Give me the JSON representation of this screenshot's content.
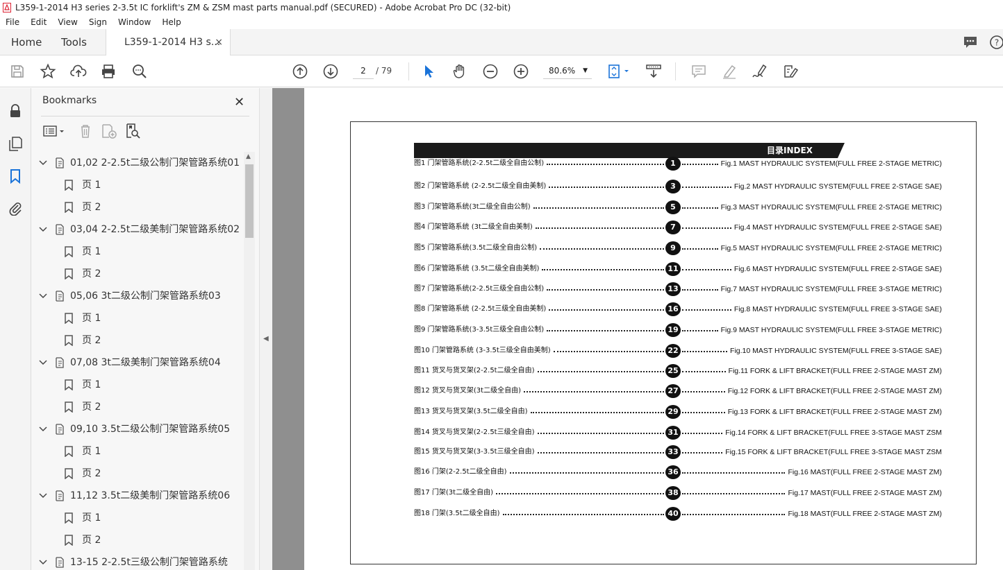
{
  "window": {
    "title": "L359-1-2014 H3 series 2-3.5t IC forklift's ZM & ZSM mast parts manual.pdf (SECURED) - Adobe Acrobat Pro DC (32-bit)"
  },
  "menu": [
    "File",
    "Edit",
    "View",
    "Sign",
    "Window",
    "Help"
  ],
  "tabs": {
    "home": "Home",
    "tools": "Tools",
    "document": "L359-1-2014 H3 s...",
    "close": "×"
  },
  "toolbar": {
    "page_current": "2",
    "page_total": "/ 79",
    "zoom": "80.6%"
  },
  "bookmarks": {
    "title": "Bookmarks",
    "close": "✕",
    "items": [
      {
        "label": "01,02 2-2.5t二级公制门架管路系统01",
        "children": [
          "页 1",
          "页 2"
        ]
      },
      {
        "label": "03,04 2-2.5t二级美制门架管路系统02",
        "children": [
          "页 1",
          "页 2"
        ]
      },
      {
        "label": "05,06 3t二级公制门架管路系统03",
        "children": [
          "页 1",
          "页 2"
        ]
      },
      {
        "label": "07,08 3t二级美制门架管路系统04",
        "children": [
          "页 1",
          "页 2"
        ]
      },
      {
        "label": "09,10 3.5t二级公制门架管路系统05",
        "children": [
          "页 1",
          "页 2"
        ]
      },
      {
        "label": "11,12 3.5t二级美制门架管路系统06",
        "children": [
          "页 1",
          "页 2"
        ]
      },
      {
        "label": "13-15 2-2.5t三级公制门架管路系统",
        "children": []
      }
    ]
  },
  "document": {
    "header": "目录INDEX",
    "entries": [
      {
        "left": "图1  门架管路系统(2-2.5t二级全自由公制)",
        "num": "1",
        "right": "Fig.1 MAST HYDRAULIC SYSTEM(FULL FREE 2-STAGE METRIC)"
      },
      {
        "left": "图2  门架管路系统 (2-2.5t二级全自由美制)",
        "num": "3",
        "right": "Fig.2 MAST HYDRAULIC SYSTEM(FULL FREE 2-STAGE SAE)"
      },
      {
        "left": "图3  门架管路系统(3t二级全自由公制)",
        "num": "5",
        "right": "Fig.3 MAST HYDRAULIC SYSTEM(FULL FREE 2-STAGE METRIC)"
      },
      {
        "left": "图4  门架管路系统 (3t二级全自由美制)",
        "num": "7",
        "right": "Fig.4 MAST HYDRAULIC SYSTEM(FULL FREE 2-STAGE SAE)"
      },
      {
        "left": "图5  门架管路系统(3.5t二级全自由公制)",
        "num": "9",
        "right": "Fig.5 MAST HYDRAULIC SYSTEM(FULL FREE 2-STAGE METRIC)"
      },
      {
        "left": "图6  门架管路系统 (3.5t二级全自由美制)",
        "num": "11",
        "right": "Fig.6 MAST HYDRAULIC SYSTEM(FULL FREE 2-STAGE SAE)"
      },
      {
        "left": "图7  门架管路系统(2-2.5t三级全自由公制)",
        "num": "13",
        "right": "Fig.7 MAST HYDRAULIC SYSTEM(FULL FREE 3-STAGE METRIC)"
      },
      {
        "left": "图8  门架管路系统 (2-2.5t三级全自由美制)",
        "num": "16",
        "right": "Fig.8 MAST HYDRAULIC SYSTEM(FULL FREE 3-STAGE SAE)"
      },
      {
        "left": "图9  门架管路系统(3-3.5t三级全自由公制)",
        "num": "19",
        "right": "Fig.9 MAST HYDRAULIC SYSTEM(FULL FREE 3-STAGE METRIC)"
      },
      {
        "left": "图10  门架管路系统 (3-3.5t三级全自由美制)",
        "num": "22",
        "right": "Fig.10 MAST HYDRAULIC SYSTEM(FULL FREE 3-STAGE SAE)"
      },
      {
        "left": "图11  货叉与货叉架(2-2.5t二级全自由)",
        "num": "25",
        "right": "Fig.11 FORK & LIFT BRACKET(FULL FREE 2-STAGE MAST ZM)"
      },
      {
        "left": "图12  货叉与货叉架(3t二级全自由)",
        "num": "27",
        "right": "Fig.12 FORK & LIFT BRACKET(FULL FREE 2-STAGE MAST ZM)"
      },
      {
        "left": "图13  货叉与货叉架(3.5t二级全自由)",
        "num": "29",
        "right": "Fig.13 FORK & LIFT BRACKET(FULL FREE 2-STAGE MAST ZM)"
      },
      {
        "left": "图14  货叉与货叉架(2-2.5t三级全自由)",
        "num": "31",
        "right": "Fig.14 FORK & LIFT BRACKET(FULL FREE 3-STAGE MAST ZSM"
      },
      {
        "left": "图15  货叉与货叉架(3-3.5t三级全自由)",
        "num": "33",
        "right": "Fig.15 FORK & LIFT BRACKET(FULL FREE 3-STAGE MAST ZSM"
      },
      {
        "left": "图16  门架(2-2.5t二级全自由)",
        "num": "36",
        "right": "Fig.16 MAST(FULL FREE 2-STAGE MAST ZM)"
      },
      {
        "left": "图17  门架(3t二级全自由)",
        "num": "38",
        "right": "Fig.17 MAST(FULL FREE 2-STAGE MAST ZM)"
      },
      {
        "left": "图18  门架(3.5t二级全自由)",
        "num": "40",
        "right": "Fig.18 MAST(FULL FREE 2-STAGE MAST ZM)"
      }
    ]
  }
}
